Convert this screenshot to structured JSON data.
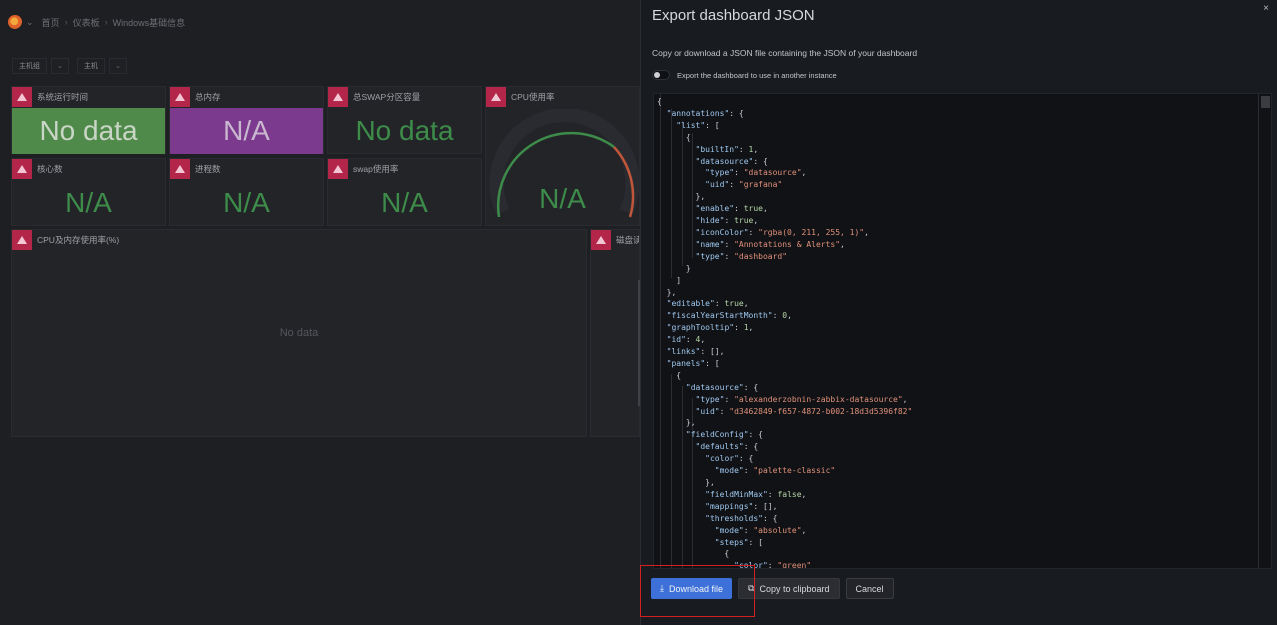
{
  "breadcrumb": {
    "home": "首页",
    "dashboards": "仪表板",
    "current": "Windows基础信息"
  },
  "variables": [
    {
      "label": "主机组",
      "value": ""
    },
    {
      "label": "主机",
      "value": ""
    }
  ],
  "panels": {
    "uptime": {
      "title": "系统运行时间",
      "value": "No data"
    },
    "total_mem": {
      "title": "总内存",
      "value": "N/A"
    },
    "swap_total": {
      "title": "总SWAP分区容量",
      "value": "No data"
    },
    "cpu_usage": {
      "title": "CPU使用率",
      "value": "N/A"
    },
    "cores": {
      "title": "核心数",
      "value": "N/A"
    },
    "processes": {
      "title": "进程数",
      "value": "N/A"
    },
    "swap_usage": {
      "title": "swap使用率",
      "value": "N/A"
    },
    "cpu_mem_graph": {
      "title": "CPU及内存使用率(%)",
      "value": "No data"
    },
    "disk": {
      "title": "磁盘读"
    }
  },
  "modal": {
    "title": "Export dashboard JSON",
    "close": "×",
    "description": "Copy or download a JSON file containing the JSON of your dashboard",
    "toggle_label": "Export the dashboard to use in another instance",
    "json_lines": [
      "{",
      "  \"annotations\": {",
      "    \"list\": [",
      "      {",
      "        \"builtIn\": 1,",
      "        \"datasource\": {",
      "          \"type\": \"datasource\",",
      "          \"uid\": \"grafana\"",
      "        },",
      "        \"enable\": true,",
      "        \"hide\": true,",
      "        \"iconColor\": \"rgba(0, 211, 255, 1)\",",
      "        \"name\": \"Annotations & Alerts\",",
      "        \"type\": \"dashboard\"",
      "      }",
      "    ]",
      "  },",
      "  \"editable\": true,",
      "  \"fiscalYearStartMonth\": 0,",
      "  \"graphTooltip\": 1,",
      "  \"id\": 4,",
      "  \"links\": [],",
      "  \"panels\": [",
      "    {",
      "      \"datasource\": {",
      "        \"type\": \"alexanderzobnin-zabbix-datasource\",",
      "        \"uid\": \"d3462849-f657-4872-b002-18d3d5396f82\"",
      "      },",
      "      \"fieldConfig\": {",
      "        \"defaults\": {",
      "          \"color\": {",
      "            \"mode\": \"palette-classic\"",
      "          },",
      "          \"fieldMinMax\": false,",
      "          \"mappings\": [],",
      "          \"thresholds\": {",
      "            \"mode\": \"absolute\",",
      "            \"steps\": [",
      "              {",
      "                \"color\": \"green\""
    ],
    "buttons": {
      "download": "Download file",
      "copy": "Copy to clipboard",
      "cancel": "Cancel"
    }
  }
}
